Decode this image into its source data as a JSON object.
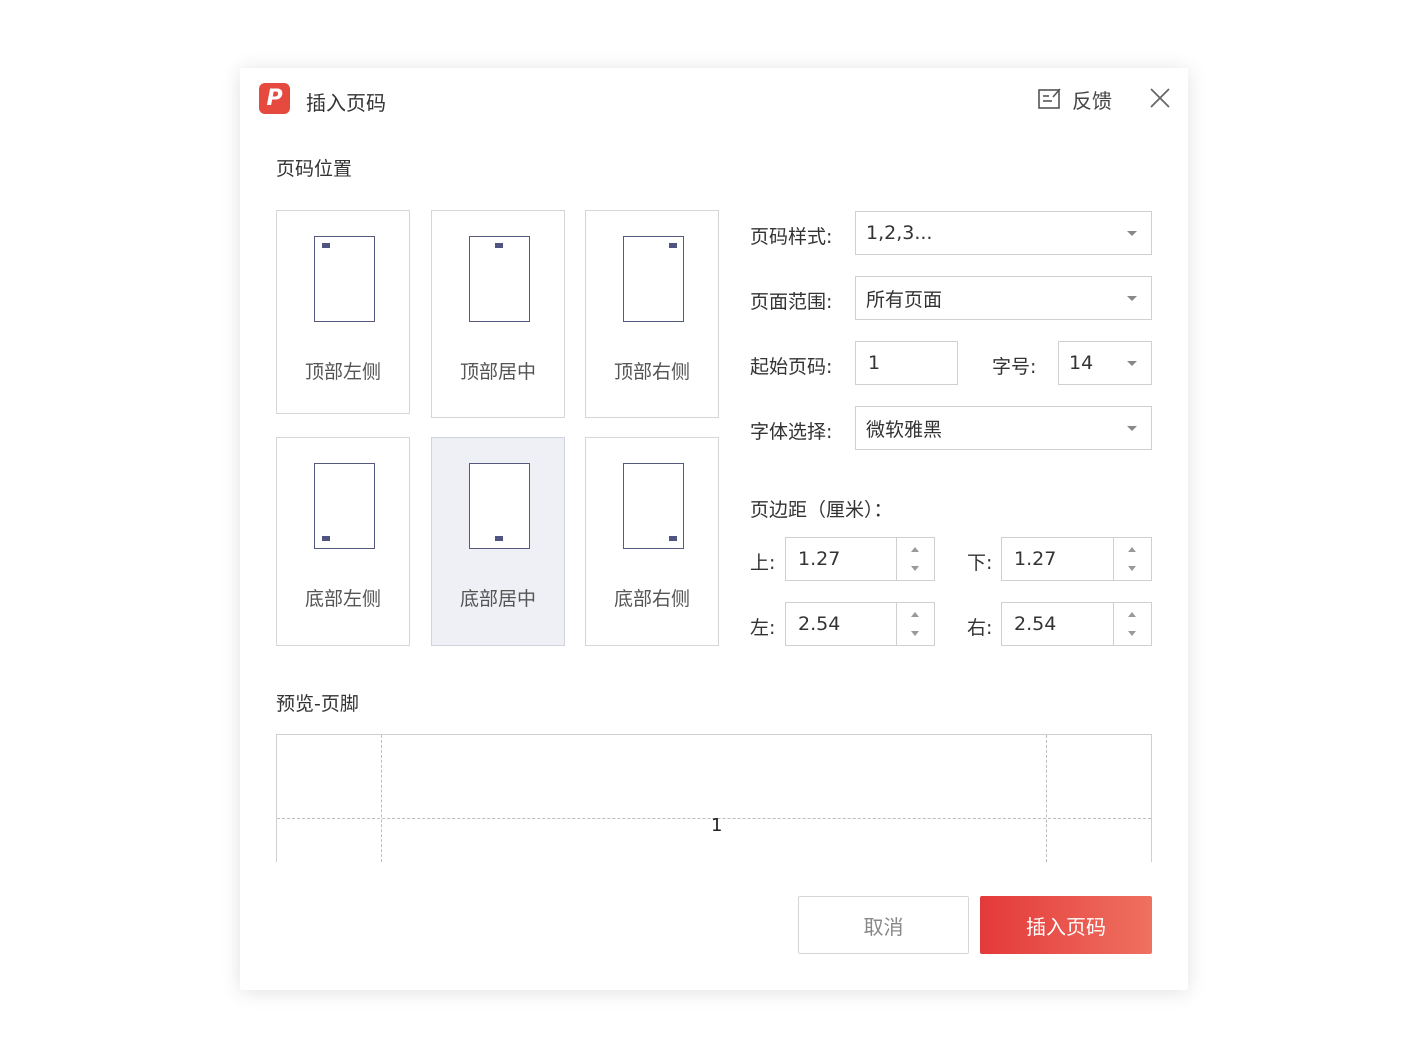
{
  "header": {
    "logo_text": "P",
    "title": "插入页码",
    "feedback_label": "反馈"
  },
  "position_section": {
    "label": "页码位置",
    "options": [
      {
        "label": "顶部左侧",
        "selected": false
      },
      {
        "label": "顶部居中",
        "selected": false
      },
      {
        "label": "顶部右侧",
        "selected": false
      },
      {
        "label": "底部左侧",
        "selected": false
      },
      {
        "label": "底部居中",
        "selected": true
      },
      {
        "label": "底部右侧",
        "selected": false
      }
    ]
  },
  "form": {
    "style_label": "页码样式:",
    "style_value": "1,2,3...",
    "range_label": "页面范围:",
    "range_value": "所有页面",
    "start_label": "起始页码:",
    "start_value": "1",
    "size_label": "字号:",
    "size_value": "14",
    "font_label": "字体选择:",
    "font_value": "微软雅黑"
  },
  "margins": {
    "label": "页边距（厘米）：",
    "top_label": "上:",
    "top_value": "1.27",
    "bottom_label": "下:",
    "bottom_value": "1.27",
    "left_label": "左:",
    "left_value": "2.54",
    "right_label": "右:",
    "right_value": "2.54"
  },
  "preview": {
    "label": "预览-页脚",
    "page_number": "1"
  },
  "footer": {
    "cancel_label": "取消",
    "insert_label": "插入页码"
  },
  "colors": {
    "accent": "#e64a3e",
    "selected_bg": "#eef0f5"
  }
}
